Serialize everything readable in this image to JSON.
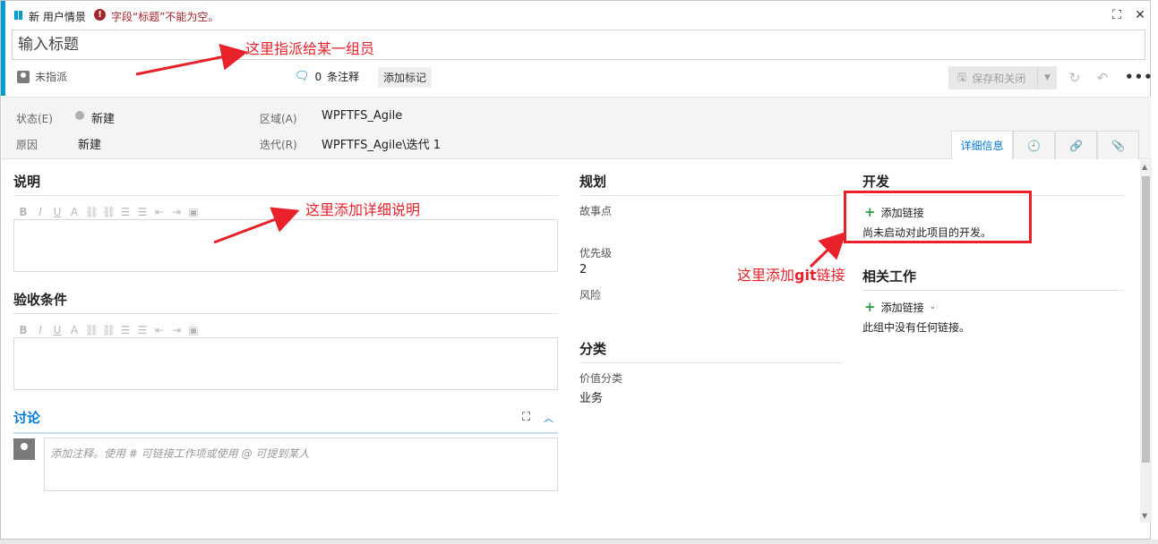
{
  "header": {
    "type_label": "新 用户情景",
    "error_text": "字段“标题”不能为空。",
    "expand_icon": "expand-icon",
    "close_icon": "close-icon"
  },
  "title": {
    "placeholder": "输入标题",
    "value": ""
  },
  "toolbar": {
    "assigned": "未指派",
    "comments_count": "0",
    "comments_label": "条注释",
    "add_tag": "添加标记",
    "save_close": "保存和关闭",
    "more": "•••"
  },
  "fields": {
    "state_label": "状态(E)",
    "state_value": "新建",
    "reason_label": "原因",
    "reason_value": "新建",
    "area_label": "区域(A)",
    "area_value": "WPFTFS_Agile",
    "iteration_label": "迭代(R)",
    "iteration_value": "WPFTFS_Agile\\迭代 1"
  },
  "tabs": {
    "details": "详细信息",
    "history_icon": "history-icon",
    "links_icon": "link-icon",
    "attachments_icon": "attachment-icon"
  },
  "description": {
    "title": "说明"
  },
  "acceptance": {
    "title": "验收条件"
  },
  "rte_toolbar": [
    "B",
    "I",
    "U",
    "A",
    "⛓",
    "⛓",
    "☰",
    "☰",
    "⇤",
    "⇥",
    "▣"
  ],
  "discussion": {
    "title": "讨论",
    "placeholder": "添加注释。使用 # 可链接工作项或使用 @ 可提到某人"
  },
  "planning": {
    "title": "规划",
    "story_points_label": "故事点",
    "priority_label": "优先级",
    "priority_value": "2",
    "risk_label": "风险"
  },
  "classification": {
    "title": "分类",
    "value_area_label": "价值分类",
    "value_area_value": "业务"
  },
  "development": {
    "title": "开发",
    "add_link": "添加链接",
    "note": "尚未启动对此项目的开发。"
  },
  "related": {
    "title": "相关工作",
    "add_link": "添加链接",
    "note": "此组中没有任何链接。"
  },
  "annotations": {
    "a1": "这里指派给某一组员",
    "a2": "这里添加详细说明",
    "a3_prefix": "这里添加",
    "a3_bold": "git",
    "a3_suffix": "链接"
  },
  "colors": {
    "accent": "#009ccc",
    "error": "#a4262c",
    "link_blue": "#0078d4",
    "annotation_red": "#e8212b",
    "plus_green": "#339947"
  }
}
